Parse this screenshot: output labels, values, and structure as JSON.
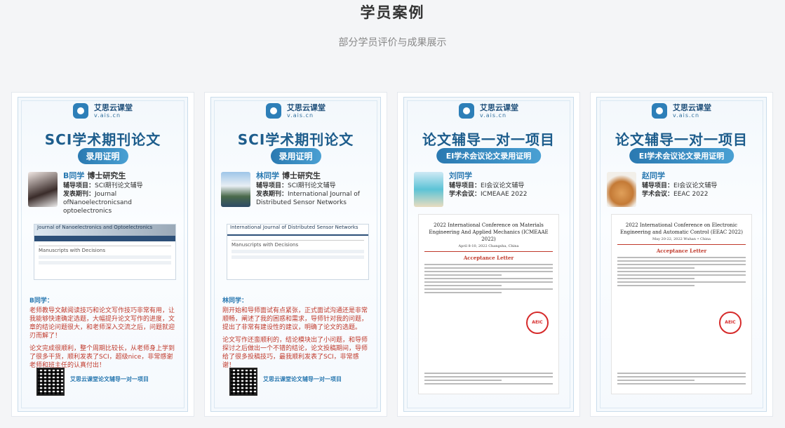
{
  "header": {
    "title": "学员案例",
    "subtitle": "部分学员评价与成果展示"
  },
  "brand": {
    "cn": "艾思云课堂",
    "en": "v.ais.cn"
  },
  "cards": [
    {
      "title": "SCI学术期刊论文",
      "badge": "录用证明",
      "name": "B同学",
      "degree": "博士研究生",
      "line1_label": "辅导项目：",
      "line1_value": "SCI期刊论文辅导",
      "line2_label": "发表期刊：",
      "line2_value": "Journal ofNanoelectronicsand optoelectronics",
      "shot_title": "Journal of Nanoelectronics and Optoelectronics",
      "shot_heading": "Manuscripts with Decisions",
      "review_name": "B同学：",
      "review_p1": "老师教导文献阅读技巧和论文写作技巧非常有用，让我能够快速确定选题，大幅提升论文写作的进度，文章的结论问题很大，和老师深入交流之后，问题就迎刃而解了！",
      "review_p2": "论文完成很顺利，整个周期比较长，从老师身上学到了很多干货，顺利发表了SCI，超级nice，非常感谢老师和班主任的认真付出！",
      "footer": "艾思云课堂论文辅导一对一项目"
    },
    {
      "title": "SCI学术期刊论文",
      "badge": "录用证明",
      "name": "林同学",
      "degree": "博士研究生",
      "line1_label": "辅导项目：",
      "line1_value": "SCI期刊论文辅导",
      "line2_label": "发表期刊：",
      "line2_value": "International Journal of Distributed Sensor Networks",
      "shot_title": "International Journal of Distributed Sensor Networks",
      "shot_heading": "Manuscripts with Decisions",
      "review_name": "林同学：",
      "review_p1": "刚开始和导师面试有点紧张，正式面试沟通还是非常顺畅，阐述了我的困惑和需求，导师针对我的问题，提出了非常有建设性的建议，明确了论文的选题。",
      "review_p2": "论文写作还蛮顺利的，结论模块出了小问题，和导师探讨之后做出一个不错的结论，论文投稿期间，导师给了很多投稿技巧，最我顺利发表了SCI，非常感谢！",
      "footer": "艾思云课堂论文辅导一对一项目"
    },
    {
      "title": "论文辅导一对一项目",
      "badge": "EI学术会议论文录用证明",
      "name": "刘同学",
      "line1_label": "辅导项目：",
      "line1_value": "EI会议论文辅导",
      "line2_label": "学术会议：",
      "line2_value": "ICMEAAE 2022",
      "conf": "2022 International Conference on Materials Engineering And Applied Mechanics (ICMEAAE 2022)",
      "date": "April 8-10, 2022 Changsha, China",
      "accept": "Acceptance Letter",
      "stamp": "AEIC"
    },
    {
      "title": "论文辅导一对一项目",
      "badge": "EI学术会议论文录用证明",
      "name": "赵同学",
      "line1_label": "辅导项目：",
      "line1_value": "EI会议论文辅导",
      "line2_label": "学术会议：",
      "line2_value": "EEAC 2022",
      "conf": "2022 International Conference on Electronic Engineering and Automatic Control (EEAC 2022)",
      "date": "May 20-22, 2022 Wuhan • China",
      "accept": "Acceptance Letter",
      "stamp": "AEIC"
    }
  ],
  "colors": {
    "accent": "#2a79b1",
    "title_blue": "#1d5d8c",
    "review_red": "#c0392b"
  }
}
